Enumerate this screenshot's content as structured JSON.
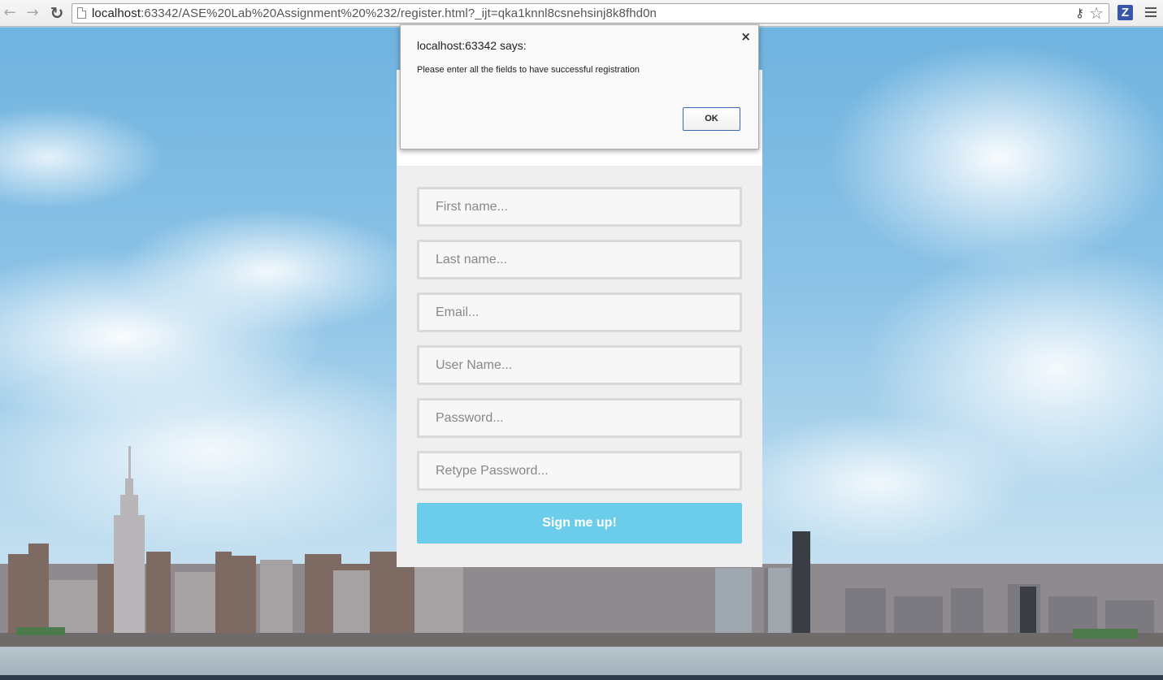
{
  "browser": {
    "url_host": "localhost",
    "url_rest": ":63342/ASE%20Lab%20Assignment%20%232/register.html?_ijt=qka1knnl8csnehsinj8k8fhd0n",
    "extension_letter": "Z",
    "icons": {
      "back": "back-arrow-icon",
      "forward": "forward-arrow-icon",
      "reload": "reload-icon",
      "page": "page-icon",
      "key": "key-icon",
      "bookmark": "star-icon",
      "menu": "hamburger-menu-icon"
    }
  },
  "dialog": {
    "title": "localhost:63342 says:",
    "message": "Please enter all the fields to have successful registration",
    "ok_label": "OK",
    "close_glyph": "×"
  },
  "form": {
    "first_name_placeholder": "First name...",
    "last_name_placeholder": "Last name...",
    "email_placeholder": "Email...",
    "username_placeholder": "User Name...",
    "password_placeholder": "Password...",
    "retype_password_placeholder": "Retype Password...",
    "submit_label": "Sign me up!"
  },
  "colors": {
    "submit_button": "#6ccdeb",
    "card_background": "#efefef",
    "field_border": "#d9d9d9",
    "ok_button_border": "#3b67b5"
  }
}
